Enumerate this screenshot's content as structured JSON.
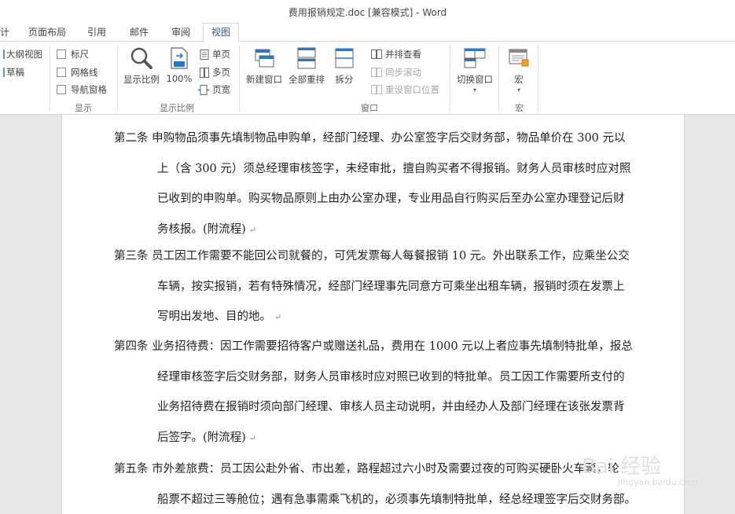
{
  "window": {
    "title": "费用报销规定.doc [兼容模式] - Word"
  },
  "tabs": [
    {
      "label": "计"
    },
    {
      "label": "页面布局"
    },
    {
      "label": "引用"
    },
    {
      "label": "邮件"
    },
    {
      "label": "审阅"
    },
    {
      "label": "视图",
      "active": true
    }
  ],
  "ribbon": {
    "views": {
      "outline": "大纲视图",
      "draft": "草稿"
    },
    "show": {
      "label": "显示",
      "ruler": "标尺",
      "gridlines": "网格线",
      "nav_pane": "导航窗格"
    },
    "zoom": {
      "label": "显示比例",
      "zoom_button": "显示比例",
      "zoom100": "100%",
      "one_page": "单页",
      "multi_page": "多页",
      "page_width": "页宽"
    },
    "window": {
      "label": "窗口",
      "new_window": "新建窗口",
      "arrange_all": "全部重排",
      "split": "拆分",
      "side_by_side": "并排查看",
      "sync_scroll": "同步滚动",
      "reset_position": "重设窗口位置",
      "switch_windows": "切换窗口"
    },
    "macros": {
      "label": "宏",
      "macro_button": "宏"
    }
  },
  "document": {
    "paragraphs": [
      {
        "lines": [
          "第二条  申购物品须事先填制物品申购单，经部门经理、办公室签字后交财务部，物品单价在 300 元以",
          "上（含 300 元）须总经理审核签字，未经审批，擅自购买者不得报销。财务人员审核时应对照",
          "已收到的申购单。购买物品原则上由办公室办理，专业用品自行购买后至办公室办理登记后财",
          "务核报。(附流程)"
        ]
      },
      {
        "lines": [
          "第三条  员工因工作需要不能回公司就餐的，可凭发票每人每餐报销 10 元。外出联系工作，应乘坐公交",
          "车辆，按实报销，若有特殊情况，经部门经理事先同意方可乘坐出租车辆，报销时须在发票上",
          "写明出发地、目的地。"
        ]
      },
      {
        "lines": [
          "第四条  业务招待费：因工作需要招待客户或赠送礼品，费用在 1000 元以上者应事先填制特批单，报总",
          "经理审核签字后交财务部，财务人员审核时应对照已收到的特批单。员工因工作需要所支付的",
          "业务招待费在报销时须向部门经理、审核人员主动说明，并由经办人及部门经理在该张发票背",
          "后签字。(附流程)"
        ]
      },
      {
        "lines": [
          "第五条  市外差旅费：员工因公赴外省、市出差，路程超过六小时及需要过夜的可购买硬卧火车票，轮",
          "船票不超过三等舱位；遇有急事需乘飞机的，必须事先填制特批单，经总经理签字后交财务部。"
        ]
      }
    ],
    "paragraph_mark": "↵"
  },
  "watermark": {
    "text": "Bai 经验",
    "sub": "jingyan.baidu.com"
  }
}
